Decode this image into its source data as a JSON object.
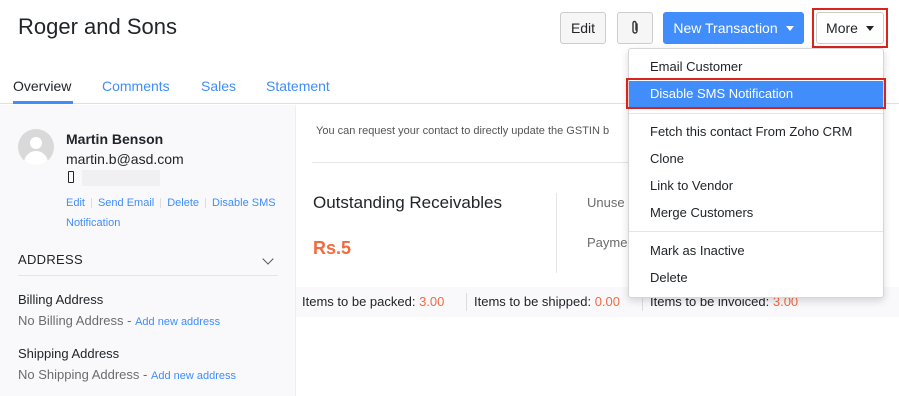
{
  "header": {
    "title": "Roger and Sons",
    "edit_label": "Edit",
    "new_transaction_label": "New Transaction",
    "more_label": "More"
  },
  "tabs": [
    {
      "label": "Overview",
      "active": true
    },
    {
      "label": "Comments",
      "active": false
    },
    {
      "label": "Sales",
      "active": false
    },
    {
      "label": "Statement",
      "active": false
    }
  ],
  "contact": {
    "name": "Martin Benson",
    "email": "martin.b@asd.com",
    "actions": [
      "Edit",
      "Send Email",
      "Delete",
      "Disable SMS Notification"
    ]
  },
  "address": {
    "header": "ADDRESS",
    "billing_label": "Billing Address",
    "billing_value": "No Billing Address -",
    "billing_link": "Add new address",
    "shipping_label": "Shipping Address",
    "shipping_value": "No Shipping Address -",
    "shipping_link": "Add new address"
  },
  "main": {
    "gstin_note": "You can request your contact to directly update the GSTIN b",
    "receivables_title": "Outstanding Receivables",
    "receivables_value": "Rs.5",
    "unused_label": "Unuse",
    "payment_label": "Payme"
  },
  "items": [
    {
      "label": "Items to be packed:",
      "value": "3.00"
    },
    {
      "label": "Items to be shipped:",
      "value": "0.00"
    },
    {
      "label": "Items to be invoiced:",
      "value": "3.00"
    }
  ],
  "more_menu": {
    "group1": [
      "Email Customer",
      "Disable SMS Notification"
    ],
    "group2": [
      "Fetch this contact From Zoho CRM",
      "Clone",
      "Link to Vendor",
      "Merge Customers"
    ],
    "group3": [
      "Mark as Inactive",
      "Delete"
    ],
    "active_item": "Disable SMS Notification"
  },
  "colors": {
    "accent": "#408dfb",
    "highlight_outline": "#d9231d",
    "amount": "#f36a3f"
  },
  "icons": {
    "attach": "paperclip-icon",
    "phone": "mobile-phone-icon",
    "avatar": "user-avatar-icon",
    "address_toggle": "chevron-down-icon"
  }
}
